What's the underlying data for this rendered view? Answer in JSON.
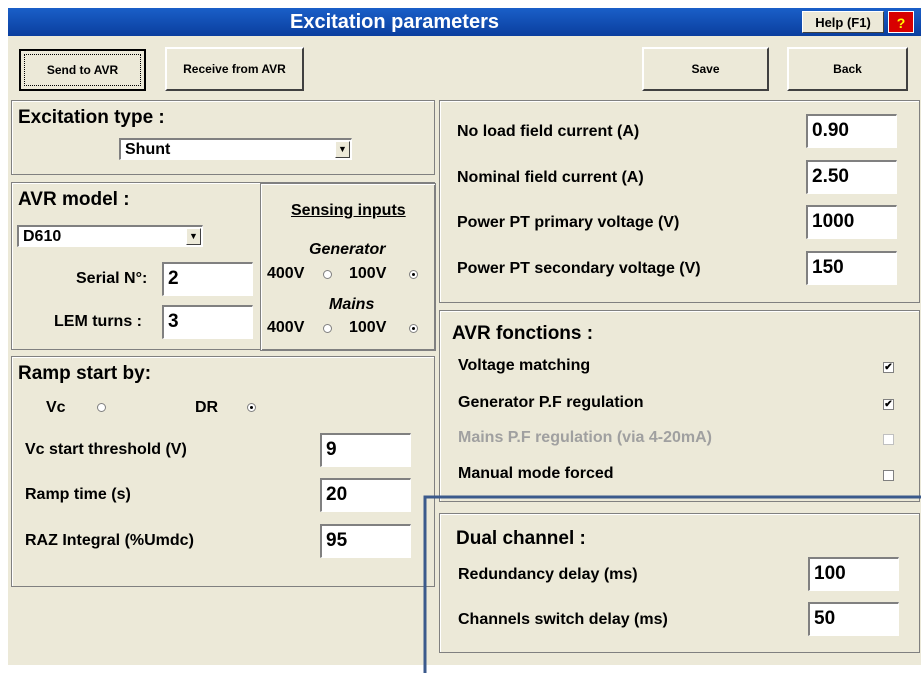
{
  "window": {
    "title": "Excitation parameters",
    "help_label": "Help (F1)",
    "question_label": "?"
  },
  "toolbar": {
    "send_label": "Send to AVR",
    "receive_label": "Receive from AVR",
    "save_label": "Save",
    "back_label": "Back"
  },
  "excitation": {
    "heading": "Excitation type :",
    "selected": "Shunt"
  },
  "avr": {
    "heading": "AVR model :",
    "model": "D610",
    "serial_label": "Serial N°:",
    "serial_value": "2",
    "lem_label": "LEM turns :",
    "lem_value": "3"
  },
  "sensing": {
    "heading": "Sensing inputs",
    "generator_label": "Generator",
    "mains_label": "Mains",
    "opt_400v": "400V",
    "opt_100v": "100V",
    "generator_selected": "100V",
    "mains_selected": "100V"
  },
  "ramp": {
    "heading": "Ramp start by:",
    "vc_label": "Vc",
    "dr_label": "DR",
    "selected": "DR",
    "vc_threshold_label": "Vc start threshold (V)",
    "vc_threshold_value": "9",
    "ramp_time_label": "Ramp time (s)",
    "ramp_time_value": "20",
    "raz_label": "RAZ Integral (%Umdc)",
    "raz_value": "95"
  },
  "field_currents": {
    "no_load_label": "No load field current (A)",
    "no_load_value": "0.90",
    "nominal_label": "Nominal field current (A)",
    "nominal_value": "2.50",
    "pt_primary_label": "Power PT primary voltage (V)",
    "pt_primary_value": "1000",
    "pt_secondary_label": "Power PT secondary voltage (V)",
    "pt_secondary_value": "150"
  },
  "functions": {
    "heading": "AVR fonctions  :",
    "items": [
      {
        "label": "Voltage matching",
        "checked": true,
        "enabled": true
      },
      {
        "label": "Generator P.F regulation",
        "checked": true,
        "enabled": true
      },
      {
        "label": "Mains P.F regulation (via 4-20mA)",
        "checked": false,
        "enabled": false
      },
      {
        "label": "Manual mode forced",
        "checked": false,
        "enabled": true
      }
    ]
  },
  "dual_channel": {
    "heading": "Dual channel :",
    "redundancy_label": "Redundancy delay (ms)",
    "redundancy_value": "100",
    "switch_label": "Channels switch delay (ms)",
    "switch_value": "50"
  },
  "colors": {
    "titlebar": "#0a3e9e",
    "window_bg": "#ece9d8",
    "annotation_line": "#3b5a8c"
  },
  "icons": {
    "dropdown": "chevron-down-icon",
    "checkmark": "checkmark-icon"
  }
}
